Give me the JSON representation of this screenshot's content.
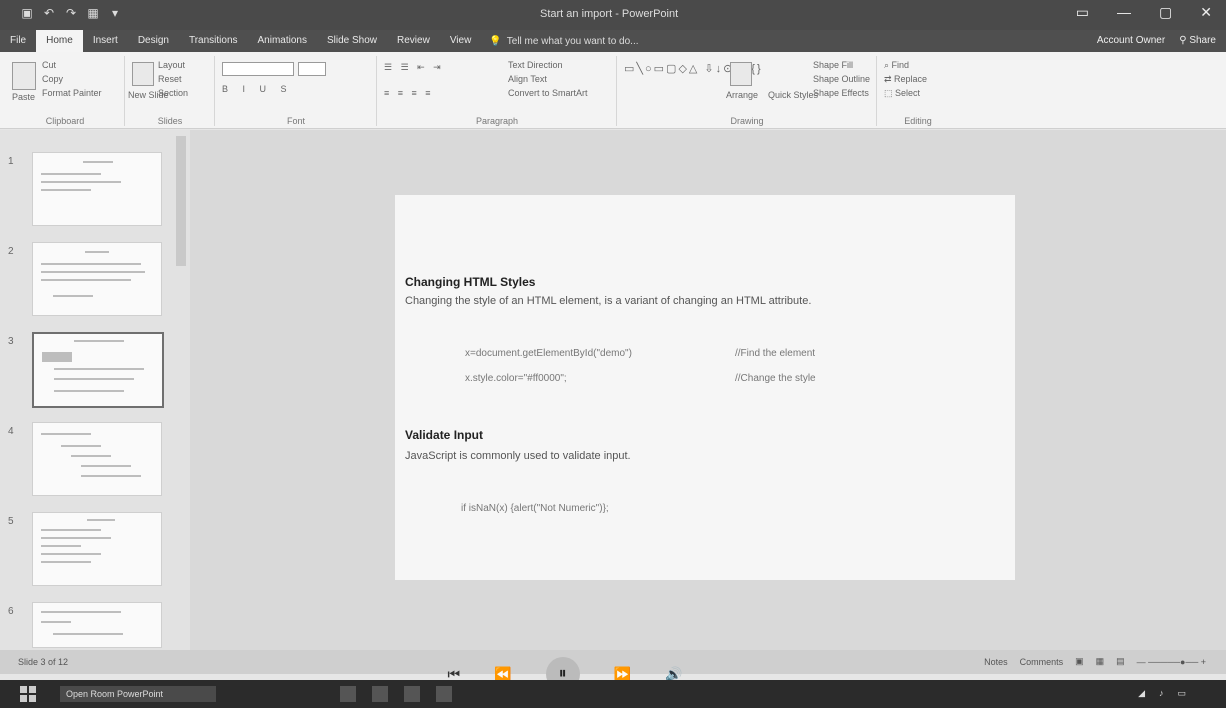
{
  "window": {
    "title": "Start an import - PowerPoint",
    "account": "Account Owner",
    "share": "Share",
    "controls": [
      "▭",
      "—",
      "▢",
      "✕"
    ]
  },
  "tabs": [
    "File",
    "Home",
    "Insert",
    "Design",
    "Transitions",
    "Animations",
    "Slide Show",
    "Review",
    "View"
  ],
  "tell_me": "Tell me what you want to do...",
  "ribbon": {
    "clipboard": {
      "paste": "Paste",
      "cut": "Cut",
      "copy": "Copy",
      "format_painter": "Format Painter",
      "label": "Clipboard"
    },
    "slides": {
      "new_slide": "New Slide",
      "layout": "Layout",
      "reset": "Reset",
      "section": "Section",
      "label": "Slides"
    },
    "font": {
      "label": "Font"
    },
    "paragraph": {
      "text_direction": "Text Direction",
      "align_text": "Align Text",
      "smartart": "Convert to SmartArt",
      "label": "Paragraph"
    },
    "drawing": {
      "arrange": "Arrange",
      "quick_styles": "Quick Styles",
      "shape_fill": "Shape Fill",
      "shape_outline": "Shape Outline",
      "shape_effects": "Shape Effects",
      "label": "Drawing"
    },
    "editing": {
      "find": "Find",
      "replace": "Replace",
      "select": "Select",
      "label": "Editing"
    }
  },
  "thumbnails": [
    {
      "num": "1"
    },
    {
      "num": "2"
    },
    {
      "num": "3"
    },
    {
      "num": "4"
    },
    {
      "num": "5"
    },
    {
      "num": "6"
    }
  ],
  "slide": {
    "heading1": "Changing HTML Styles",
    "para1": "Changing the style of an HTML element, is a variant of changing an HTML attribute.",
    "code1a": "x=document.getElementById(\"demo\")",
    "code1b": "x.style.color=\"#ff0000\";",
    "comment1a": "//Find the element",
    "comment1b": "//Change the style",
    "heading2": "Validate Input",
    "para2": "JavaScript is commonly used to validate input.",
    "code2": "if isNaN(x) {alert(\"Not Numeric\")};"
  },
  "status": {
    "left": "Slide 3 of 12",
    "notes": "Notes",
    "comments": "Comments"
  },
  "taskbar": {
    "task": "Open Room PowerPoint"
  }
}
